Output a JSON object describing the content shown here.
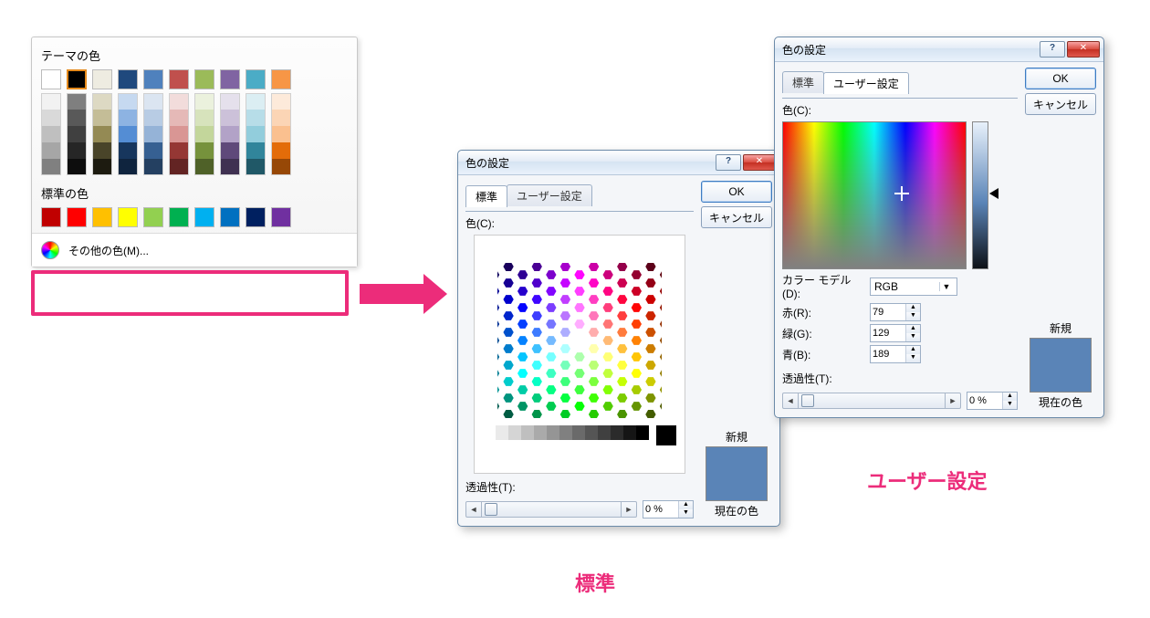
{
  "dropdown": {
    "theme_label": "テーマの色",
    "standard_label": "標準の色",
    "more_colors_label": "その他の色(M)...",
    "theme_colors": [
      "#ffffff",
      "#000000",
      "#eeece1",
      "#1f497d",
      "#4f81bd",
      "#c0504d",
      "#9bbb59",
      "#8064a2",
      "#4bacc6",
      "#f79646"
    ],
    "selected_index": 1,
    "tints": [
      [
        "#f2f2f2",
        "#d9d9d9",
        "#bfbfbf",
        "#a6a6a6",
        "#808080"
      ],
      [
        "#7f7f7f",
        "#595959",
        "#404040",
        "#262626",
        "#0d0d0d"
      ],
      [
        "#ddd9c3",
        "#c4bd97",
        "#948a54",
        "#494429",
        "#1d1b10"
      ],
      [
        "#c6d9f0",
        "#8db3e2",
        "#548dd4",
        "#17365d",
        "#0f243e"
      ],
      [
        "#dbe5f1",
        "#b8cce4",
        "#95b3d7",
        "#366092",
        "#244061"
      ],
      [
        "#f2dcdb",
        "#e5b9b7",
        "#d99694",
        "#953734",
        "#632423"
      ],
      [
        "#ebf1dd",
        "#d7e3bc",
        "#c3d69b",
        "#76923c",
        "#4f6128"
      ],
      [
        "#e5e0ec",
        "#ccc1d9",
        "#b2a2c7",
        "#5f497a",
        "#3f3151"
      ],
      [
        "#dbeef3",
        "#b7dde8",
        "#92cddc",
        "#31859b",
        "#205867"
      ],
      [
        "#fdeada",
        "#fbd5b5",
        "#fac08f",
        "#e36c09",
        "#974806"
      ]
    ],
    "standard_colors": [
      "#c00000",
      "#ff0000",
      "#ffc000",
      "#ffff00",
      "#92d050",
      "#00b050",
      "#00b0f0",
      "#0070c0",
      "#002060",
      "#7030a0"
    ]
  },
  "dialog_shared": {
    "title": "色の設定",
    "tab_standard": "標準",
    "tab_custom": "ユーザー設定",
    "color_label": "色(C):",
    "ok": "OK",
    "cancel": "キャンセル",
    "new_label": "新規",
    "current_label": "現在の色",
    "transparency_label": "透過性(T):",
    "transparency_value": "0 %",
    "preview_color": "#5a84b7"
  },
  "custom_dialog": {
    "model_label": "カラー モデル(D):",
    "model_value": "RGB",
    "r_label": "赤(R):",
    "g_label": "緑(G):",
    "b_label": "青(B):",
    "r": "79",
    "g": "129",
    "b": "189"
  },
  "captions": {
    "standard": "標準",
    "custom": "ユーザー設定"
  }
}
